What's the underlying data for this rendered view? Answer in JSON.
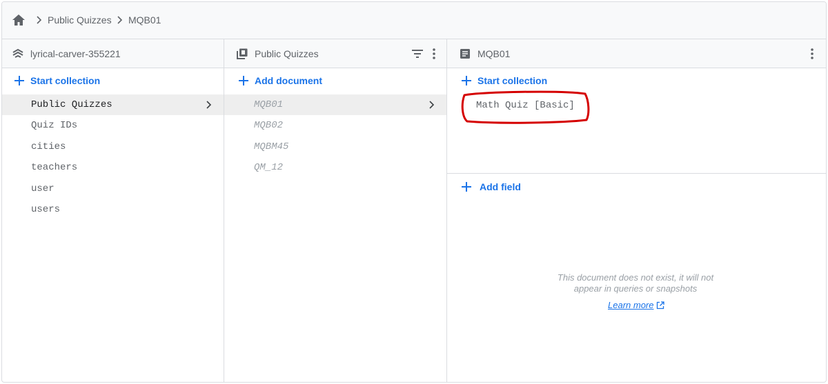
{
  "breadcrumb": {
    "home_icon": "home-icon",
    "items": [
      "Public Quizzes",
      "MQB01"
    ]
  },
  "project_panel": {
    "title": "lyrical-carver-355221",
    "icon": "firestore-icon",
    "start_collection_label": "Start collection",
    "collections": [
      {
        "label": "Public Quizzes",
        "selected": true
      },
      {
        "label": "Quiz IDs"
      },
      {
        "label": "cities"
      },
      {
        "label": "teachers"
      },
      {
        "label": "user"
      },
      {
        "label": "users"
      }
    ]
  },
  "collection_panel": {
    "title": "Public Quizzes",
    "icon": "collection-icon",
    "add_document_label": "Add document",
    "documents": [
      {
        "label": "MQB01",
        "selected": true
      },
      {
        "label": "MQB02"
      },
      {
        "label": "MQBM45"
      },
      {
        "label": "QM_12"
      }
    ]
  },
  "document_panel": {
    "title": "MQB01",
    "icon": "document-icon",
    "start_collection_label": "Start collection",
    "subcollections": [
      {
        "label": "Math Quiz [Basic]"
      }
    ],
    "add_field_label": "Add field",
    "empty_message_line1": "This document does not exist, it will not",
    "empty_message_line2": "appear in queries or snapshots",
    "learn_more_label": "Learn more"
  },
  "colors": {
    "accent": "#1a73e8",
    "annotation": "#d50000",
    "border": "#dadce0",
    "header_bg": "#f8f9fa"
  }
}
